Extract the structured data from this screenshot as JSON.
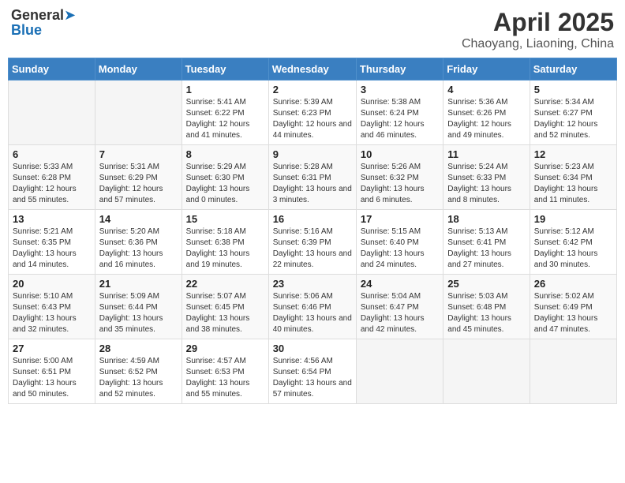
{
  "header": {
    "logo_general": "General",
    "logo_blue": "Blue",
    "month_year": "April 2025",
    "location": "Chaoyang, Liaoning, China"
  },
  "weekdays": [
    "Sunday",
    "Monday",
    "Tuesday",
    "Wednesday",
    "Thursday",
    "Friday",
    "Saturday"
  ],
  "weeks": [
    [
      {
        "day": "",
        "sunrise": "",
        "sunset": "",
        "daylight": ""
      },
      {
        "day": "",
        "sunrise": "",
        "sunset": "",
        "daylight": ""
      },
      {
        "day": "1",
        "sunrise": "Sunrise: 5:41 AM",
        "sunset": "Sunset: 6:22 PM",
        "daylight": "Daylight: 12 hours and 41 minutes."
      },
      {
        "day": "2",
        "sunrise": "Sunrise: 5:39 AM",
        "sunset": "Sunset: 6:23 PM",
        "daylight": "Daylight: 12 hours and 44 minutes."
      },
      {
        "day": "3",
        "sunrise": "Sunrise: 5:38 AM",
        "sunset": "Sunset: 6:24 PM",
        "daylight": "Daylight: 12 hours and 46 minutes."
      },
      {
        "day": "4",
        "sunrise": "Sunrise: 5:36 AM",
        "sunset": "Sunset: 6:26 PM",
        "daylight": "Daylight: 12 hours and 49 minutes."
      },
      {
        "day": "5",
        "sunrise": "Sunrise: 5:34 AM",
        "sunset": "Sunset: 6:27 PM",
        "daylight": "Daylight: 12 hours and 52 minutes."
      }
    ],
    [
      {
        "day": "6",
        "sunrise": "Sunrise: 5:33 AM",
        "sunset": "Sunset: 6:28 PM",
        "daylight": "Daylight: 12 hours and 55 minutes."
      },
      {
        "day": "7",
        "sunrise": "Sunrise: 5:31 AM",
        "sunset": "Sunset: 6:29 PM",
        "daylight": "Daylight: 12 hours and 57 minutes."
      },
      {
        "day": "8",
        "sunrise": "Sunrise: 5:29 AM",
        "sunset": "Sunset: 6:30 PM",
        "daylight": "Daylight: 13 hours and 0 minutes."
      },
      {
        "day": "9",
        "sunrise": "Sunrise: 5:28 AM",
        "sunset": "Sunset: 6:31 PM",
        "daylight": "Daylight: 13 hours and 3 minutes."
      },
      {
        "day": "10",
        "sunrise": "Sunrise: 5:26 AM",
        "sunset": "Sunset: 6:32 PM",
        "daylight": "Daylight: 13 hours and 6 minutes."
      },
      {
        "day": "11",
        "sunrise": "Sunrise: 5:24 AM",
        "sunset": "Sunset: 6:33 PM",
        "daylight": "Daylight: 13 hours and 8 minutes."
      },
      {
        "day": "12",
        "sunrise": "Sunrise: 5:23 AM",
        "sunset": "Sunset: 6:34 PM",
        "daylight": "Daylight: 13 hours and 11 minutes."
      }
    ],
    [
      {
        "day": "13",
        "sunrise": "Sunrise: 5:21 AM",
        "sunset": "Sunset: 6:35 PM",
        "daylight": "Daylight: 13 hours and 14 minutes."
      },
      {
        "day": "14",
        "sunrise": "Sunrise: 5:20 AM",
        "sunset": "Sunset: 6:36 PM",
        "daylight": "Daylight: 13 hours and 16 minutes."
      },
      {
        "day": "15",
        "sunrise": "Sunrise: 5:18 AM",
        "sunset": "Sunset: 6:38 PM",
        "daylight": "Daylight: 13 hours and 19 minutes."
      },
      {
        "day": "16",
        "sunrise": "Sunrise: 5:16 AM",
        "sunset": "Sunset: 6:39 PM",
        "daylight": "Daylight: 13 hours and 22 minutes."
      },
      {
        "day": "17",
        "sunrise": "Sunrise: 5:15 AM",
        "sunset": "Sunset: 6:40 PM",
        "daylight": "Daylight: 13 hours and 24 minutes."
      },
      {
        "day": "18",
        "sunrise": "Sunrise: 5:13 AM",
        "sunset": "Sunset: 6:41 PM",
        "daylight": "Daylight: 13 hours and 27 minutes."
      },
      {
        "day": "19",
        "sunrise": "Sunrise: 5:12 AM",
        "sunset": "Sunset: 6:42 PM",
        "daylight": "Daylight: 13 hours and 30 minutes."
      }
    ],
    [
      {
        "day": "20",
        "sunrise": "Sunrise: 5:10 AM",
        "sunset": "Sunset: 6:43 PM",
        "daylight": "Daylight: 13 hours and 32 minutes."
      },
      {
        "day": "21",
        "sunrise": "Sunrise: 5:09 AM",
        "sunset": "Sunset: 6:44 PM",
        "daylight": "Daylight: 13 hours and 35 minutes."
      },
      {
        "day": "22",
        "sunrise": "Sunrise: 5:07 AM",
        "sunset": "Sunset: 6:45 PM",
        "daylight": "Daylight: 13 hours and 38 minutes."
      },
      {
        "day": "23",
        "sunrise": "Sunrise: 5:06 AM",
        "sunset": "Sunset: 6:46 PM",
        "daylight": "Daylight: 13 hours and 40 minutes."
      },
      {
        "day": "24",
        "sunrise": "Sunrise: 5:04 AM",
        "sunset": "Sunset: 6:47 PM",
        "daylight": "Daylight: 13 hours and 42 minutes."
      },
      {
        "day": "25",
        "sunrise": "Sunrise: 5:03 AM",
        "sunset": "Sunset: 6:48 PM",
        "daylight": "Daylight: 13 hours and 45 minutes."
      },
      {
        "day": "26",
        "sunrise": "Sunrise: 5:02 AM",
        "sunset": "Sunset: 6:49 PM",
        "daylight": "Daylight: 13 hours and 47 minutes."
      }
    ],
    [
      {
        "day": "27",
        "sunrise": "Sunrise: 5:00 AM",
        "sunset": "Sunset: 6:51 PM",
        "daylight": "Daylight: 13 hours and 50 minutes."
      },
      {
        "day": "28",
        "sunrise": "Sunrise: 4:59 AM",
        "sunset": "Sunset: 6:52 PM",
        "daylight": "Daylight: 13 hours and 52 minutes."
      },
      {
        "day": "29",
        "sunrise": "Sunrise: 4:57 AM",
        "sunset": "Sunset: 6:53 PM",
        "daylight": "Daylight: 13 hours and 55 minutes."
      },
      {
        "day": "30",
        "sunrise": "Sunrise: 4:56 AM",
        "sunset": "Sunset: 6:54 PM",
        "daylight": "Daylight: 13 hours and 57 minutes."
      },
      {
        "day": "",
        "sunrise": "",
        "sunset": "",
        "daylight": ""
      },
      {
        "day": "",
        "sunrise": "",
        "sunset": "",
        "daylight": ""
      },
      {
        "day": "",
        "sunrise": "",
        "sunset": "",
        "daylight": ""
      }
    ]
  ]
}
